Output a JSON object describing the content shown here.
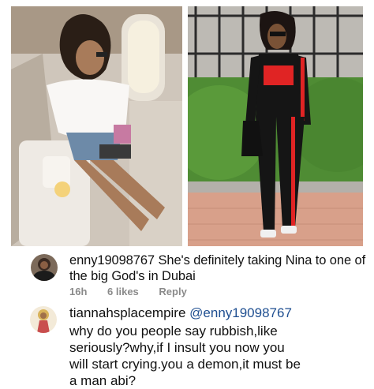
{
  "comments": [
    {
      "username": "enny19098767",
      "text": "She's definitely taking Nina to one of the big God's in Dubai",
      "time": "16h",
      "likes": "6 likes",
      "reply": "Reply"
    },
    {
      "username": "tiannahsplacempire",
      "mention": "@enny19098767",
      "text": "why do you people say rubbish,like seriously?why,if I insult you now you will start crying.you a demon,it must be a man abi?"
    }
  ],
  "colors": {
    "mention": "#1f4f91",
    "meta": "#8a8a8a"
  }
}
